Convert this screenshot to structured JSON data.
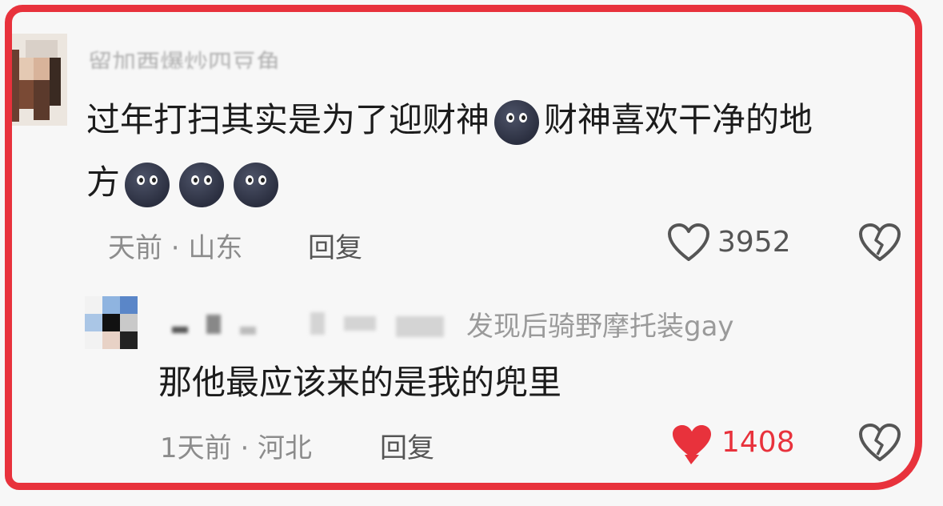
{
  "comments": [
    {
      "username": "留加酉爆炒四豆角",
      "text_line1": "过年打扫其实是为了迎财神",
      "text_line1b": "财神喜欢干净的地",
      "text_line2": "方",
      "emoji_icon": "new-moon-face-icon",
      "time_location": "天前 · 山东",
      "reply": "回复",
      "like_count": "3952",
      "liked": false
    },
    {
      "username": "发现后骑野摩托装gay",
      "text": "那他最应该来的是我的兜里",
      "time_location": "1天前 · 河北",
      "reply": "回复",
      "like_count": "1408",
      "liked": true
    }
  ],
  "colors": {
    "frame": "#e8323c",
    "liked": "#e8323c",
    "meta": "#8c8c8c"
  }
}
